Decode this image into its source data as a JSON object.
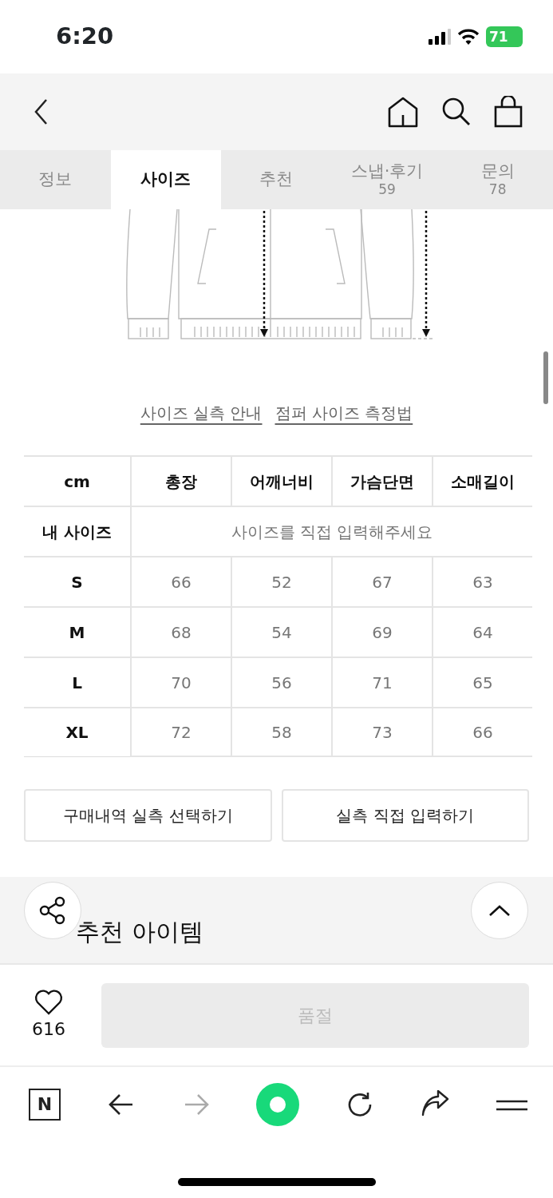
{
  "status_bar": {
    "time": "6:20",
    "battery": "71"
  },
  "tabs": [
    {
      "label": "정보",
      "selected": false
    },
    {
      "label": "사이즈",
      "selected": true
    },
    {
      "label": "추천",
      "selected": false
    },
    {
      "label": "스냅·후기",
      "count": "59",
      "selected": false
    },
    {
      "label": "문의",
      "count": "78",
      "selected": false
    }
  ],
  "size_links": [
    "사이즈 실측 안내",
    "점퍼 사이즈 측정법"
  ],
  "size_table": {
    "columns": [
      "cm",
      "총장",
      "어깨너비",
      "가슴단면",
      "소매길이"
    ],
    "my_size": {
      "label": "내 사이즈",
      "placeholder": "사이즈를 직접 입력해주세요"
    },
    "rows": [
      {
        "size": "S",
        "values": [
          "66",
          "52",
          "67",
          "63"
        ]
      },
      {
        "size": "M",
        "values": [
          "68",
          "54",
          "69",
          "64"
        ]
      },
      {
        "size": "L",
        "values": [
          "70",
          "56",
          "71",
          "65"
        ]
      },
      {
        "size": "XL",
        "values": [
          "72",
          "58",
          "73",
          "66"
        ]
      }
    ]
  },
  "size_buttons": [
    "구매내역 실측 선택하기",
    "실측 직접 입력하기"
  ],
  "recommend_section": {
    "title": "추천 아이템"
  },
  "purchase_bar": {
    "likes": "616",
    "liked": false,
    "button": "품절",
    "disabled": true
  },
  "browser_toolbar": [
    {
      "kind": "logo",
      "label": "N",
      "disabled": false
    },
    {
      "kind": "back",
      "disabled": false
    },
    {
      "kind": "forward",
      "disabled": true
    },
    {
      "kind": "home",
      "disabled": false
    },
    {
      "kind": "reload",
      "disabled": false
    },
    {
      "kind": "share",
      "disabled": false
    },
    {
      "kind": "menu",
      "disabled": false
    }
  ]
}
